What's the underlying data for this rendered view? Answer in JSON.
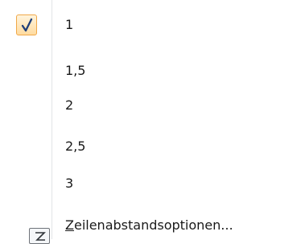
{
  "menu": {
    "spacing_options": [
      {
        "label": "1",
        "checked": true
      },
      {
        "label": "1,5",
        "checked": false
      },
      {
        "label": "2",
        "checked": false
      },
      {
        "label": "2,5",
        "checked": false
      },
      {
        "label": "3",
        "checked": false
      }
    ],
    "more_options": {
      "mnemonic": "Z",
      "label_rest": "eilenabstandsoptionen..."
    }
  },
  "colors": {
    "checked_fill": "#ffdca0",
    "checked_border": "#f0a848",
    "checkmark": "#1f3f7a"
  },
  "icons": {
    "checked_item": "checkmark-icon",
    "more_options": "dialog-launcher-icon"
  }
}
